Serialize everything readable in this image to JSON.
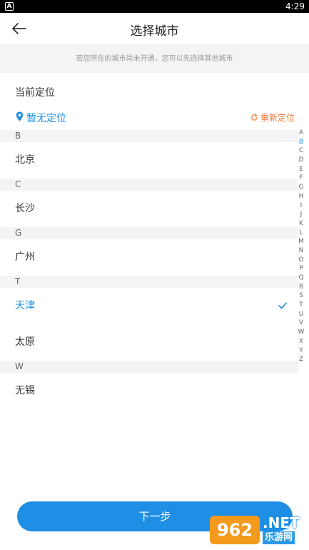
{
  "status_bar": {
    "app_icon": "A",
    "time": "4:29"
  },
  "header": {
    "title": "选择城市",
    "back_icon": "arrow-left-icon"
  },
  "notice": "若您所在的城市尚未开通，您可以先选择其他城市",
  "current_location": {
    "label": "当前定位",
    "value": "暂无定位",
    "relocate_label": "重新定位"
  },
  "sections": [
    {
      "letter": "B",
      "cities": [
        {
          "name": "北京",
          "selected": false
        }
      ]
    },
    {
      "letter": "C",
      "cities": [
        {
          "name": "长沙",
          "selected": false
        }
      ]
    },
    {
      "letter": "G",
      "cities": [
        {
          "name": "广州",
          "selected": false
        }
      ]
    },
    {
      "letter": "T",
      "cities": [
        {
          "name": "天津",
          "selected": true
        },
        {
          "name": "太原",
          "selected": false
        }
      ]
    },
    {
      "letter": "W",
      "cities": [
        {
          "name": "无锡",
          "selected": false
        }
      ]
    }
  ],
  "index_letters": [
    "A",
    "B",
    "C",
    "D",
    "E",
    "F",
    "G",
    "H",
    "I",
    "J",
    "K",
    "L",
    "M",
    "N",
    "O",
    "P",
    "Q",
    "R",
    "S",
    "T",
    "U",
    "V",
    "W",
    "X",
    "Y",
    "Z"
  ],
  "active_index_letter": "B",
  "next_button": "下一步",
  "watermark": {
    "badge": "962",
    "net": ".NET",
    "sub": "乐游网"
  },
  "colors": {
    "accent": "#1f8fe5",
    "relocate": "#f07a3a",
    "section_bg": "#f4f4f6"
  }
}
